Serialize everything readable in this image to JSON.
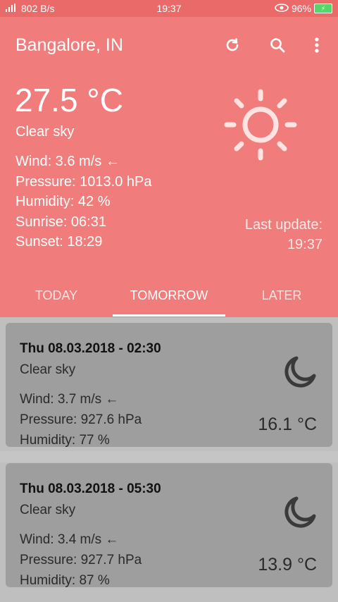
{
  "status_bar": {
    "network": "802 B/s",
    "time": "19:37",
    "battery": "96%"
  },
  "header": {
    "city": "Bangalore, IN",
    "temperature": "27.5 °C",
    "description": "Clear sky",
    "wind": "Wind: 3.6 m/s ←",
    "pressure": "Pressure: 1013.0 hPa",
    "humidity": "Humidity: 42 %",
    "sunrise": "Sunrise: 06:31",
    "sunset": "Sunset: 18:29",
    "last_update_label": "Last update:",
    "last_update_time": "19:37",
    "icons": [
      "refresh-icon",
      "search-icon",
      "more-vert-icon",
      "sun-icon"
    ]
  },
  "tabs": [
    {
      "label": "TODAY"
    },
    {
      "label": "TOMORROW",
      "active": true
    },
    {
      "label": "LATER"
    }
  ],
  "forecasts": [
    {
      "when": "Thu 08.03.2018 - 02:30",
      "description": "Clear sky",
      "wind": "Wind: 3.7 m/s ←",
      "pressure": "Pressure: 927.6 hPa",
      "humidity": "Humidity: 77 %",
      "temperature": "16.1 °C",
      "icon": "moon-icon"
    },
    {
      "when": "Thu 08.03.2018 - 05:30",
      "description": "Clear sky",
      "wind": "Wind: 3.4 m/s ←",
      "pressure": "Pressure: 927.7 hPa",
      "humidity": "Humidity: 87 %",
      "temperature": "13.9 °C",
      "icon": "moon-icon"
    }
  ],
  "colors": {
    "status_bar": "#ea6a6a",
    "header": "#f07c7c",
    "card": "#9e9e9e",
    "list_background": "#bfbfbf"
  }
}
